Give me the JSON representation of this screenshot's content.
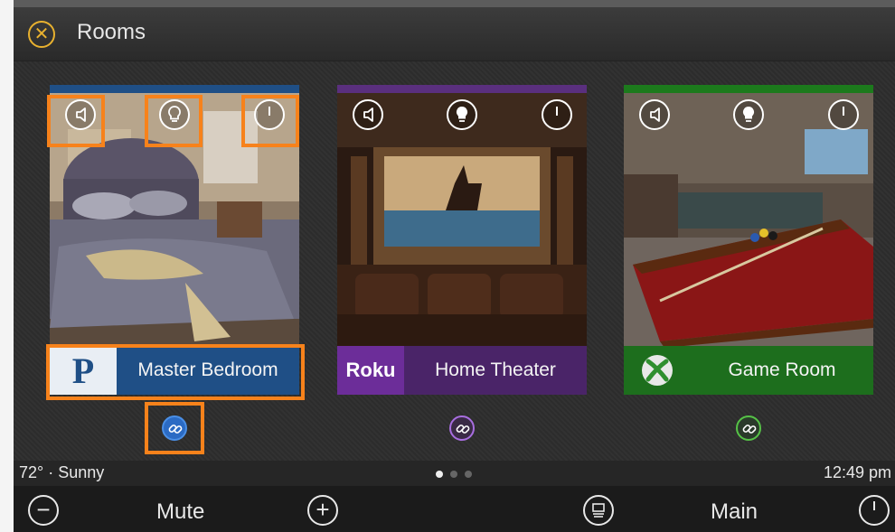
{
  "header": {
    "title": "Rooms",
    "close_icon": "close-icon"
  },
  "rooms": [
    {
      "name": "Master Bedroom",
      "source_logo": "P",
      "source": "pandora",
      "accent": "#1f4f86",
      "label_bg": "#1f4f86",
      "link_color": "#4a8fe6",
      "controls": [
        "volume-icon",
        "light-bulb-icon",
        "power-icon"
      ]
    },
    {
      "name": "Home Theater",
      "source_logo": "Roku",
      "source": "roku",
      "accent": "#5a2f7e",
      "label_bg": "#4a2468",
      "link_color": "#a86ee0",
      "controls": [
        "volume-icon",
        "light-bulb-icon",
        "power-icon"
      ]
    },
    {
      "name": "Game Room",
      "source_logo": "xbox",
      "source": "xbox",
      "accent": "#1c7a1c",
      "label_bg": "#1d6e1d",
      "link_color": "#56c247",
      "controls": [
        "volume-icon",
        "light-bulb-icon",
        "power-icon"
      ]
    }
  ],
  "status": {
    "weather": "72° · Sunny",
    "time": "12:49 pm",
    "page_count": 3,
    "active_page": 1
  },
  "bottom_bar": {
    "mute_label": "Mute",
    "main_label": "Main"
  },
  "colors": {
    "highlight": "#f7821b",
    "close_accent": "#e8b12f"
  }
}
